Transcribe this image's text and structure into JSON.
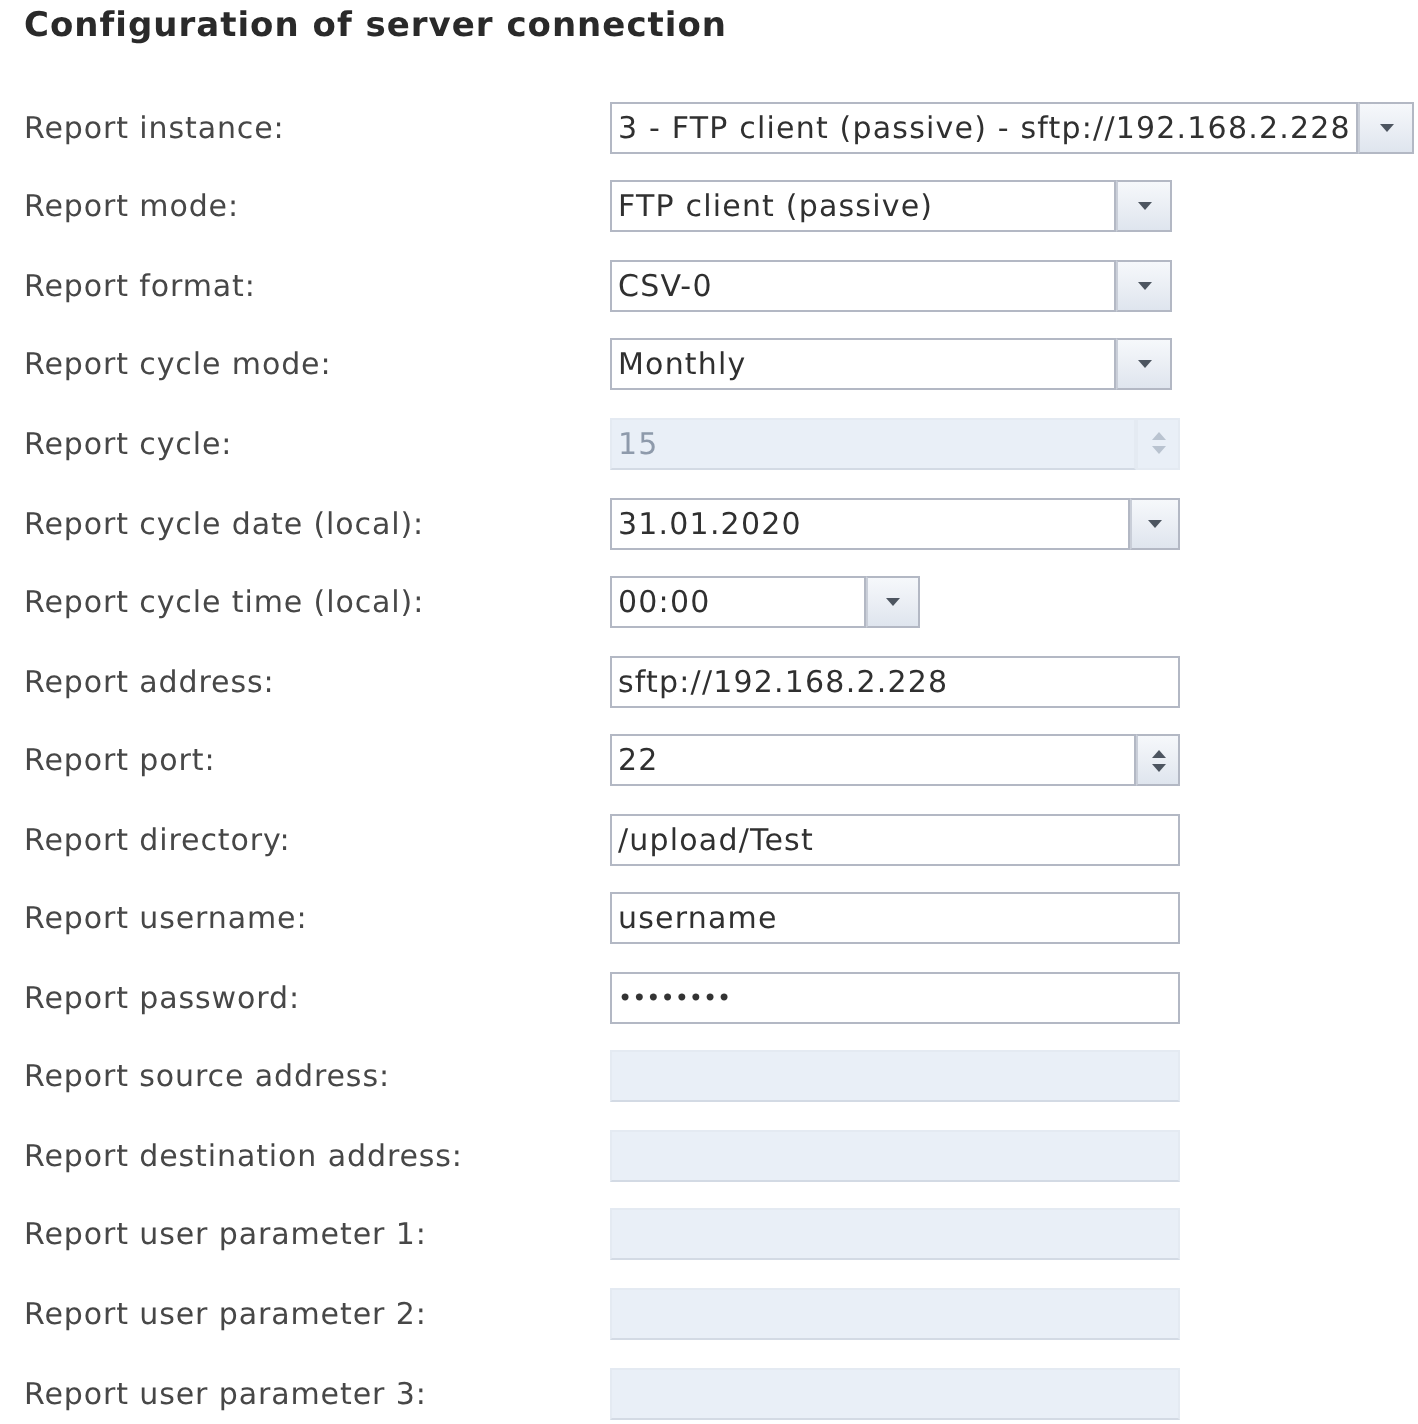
{
  "title": "Configuration of server connection",
  "fields": [
    {
      "label": "Report instance:",
      "kind": "select",
      "value": "3 - FTP client (passive) - sftp://192.168.2.228",
      "disabled": false
    },
    {
      "label": "Report mode:",
      "kind": "select",
      "value": "FTP client (passive)",
      "disabled": false
    },
    {
      "label": "Report format:",
      "kind": "select",
      "value": "CSV-0",
      "disabled": false
    },
    {
      "label": "Report cycle mode:",
      "kind": "select",
      "value": "Monthly",
      "disabled": false
    },
    {
      "label": "Report cycle:",
      "kind": "spinner",
      "value": "15",
      "disabled": true
    },
    {
      "label": "Report cycle date (local):",
      "kind": "date",
      "value": "31.01.2020",
      "disabled": false
    },
    {
      "label": "Report cycle time (local):",
      "kind": "time",
      "value": "00:00",
      "disabled": false
    },
    {
      "label": "Report address:",
      "kind": "text",
      "value": "sftp://192.168.2.228",
      "disabled": false
    },
    {
      "label": "Report port:",
      "kind": "spinner",
      "value": "22",
      "disabled": false
    },
    {
      "label": "Report directory:",
      "kind": "text",
      "value": "/upload/Test",
      "disabled": false
    },
    {
      "label": "Report username:",
      "kind": "text",
      "value": "username",
      "disabled": false
    },
    {
      "label": "Report password:",
      "kind": "password",
      "value": "••••••••",
      "disabled": false
    },
    {
      "label": "Report source address:",
      "kind": "text",
      "disabled": true
    },
    {
      "label": "Report destination address:",
      "kind": "text",
      "disabled": true
    },
    {
      "label": "Report user parameter 1:",
      "kind": "text",
      "disabled": true
    },
    {
      "label": "Report user parameter 2:",
      "kind": "text",
      "disabled": true
    },
    {
      "label": "Report user parameter 3:",
      "kind": "text",
      "disabled": true
    }
  ]
}
